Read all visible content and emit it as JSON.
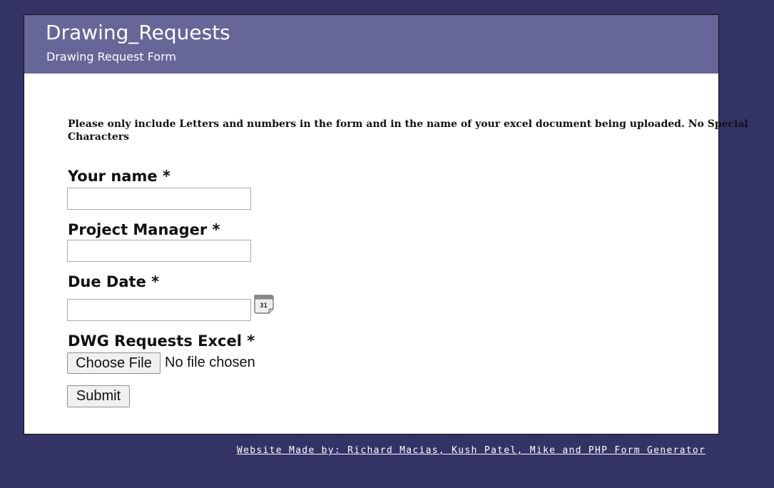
{
  "header": {
    "title": "Drawing_Requests",
    "subtitle": "Drawing Request Form",
    "background": "#666699"
  },
  "page_background": "#333366",
  "notice": {
    "line1": "Please only include Letters and numbers in the form and in the name of your excel document being uploaded. No Special",
    "line2": "Characters"
  },
  "form": {
    "your_name_label": "Your name *",
    "your_name_value": "",
    "project_manager_label": "Project Manager *",
    "project_manager_value": "",
    "due_date_label": "Due Date *",
    "due_date_value": "",
    "calendar_icon": "calendar-icon",
    "calendar_day": "31",
    "excel_label": "DWG Requests Excel *",
    "choose_file_label": "Choose File",
    "file_status": "No file chosen",
    "submit_label": "Submit"
  },
  "footer": {
    "credit": "Website Made by: Richard Macias, Kush Patel, Mike and PHP Form Generator"
  }
}
